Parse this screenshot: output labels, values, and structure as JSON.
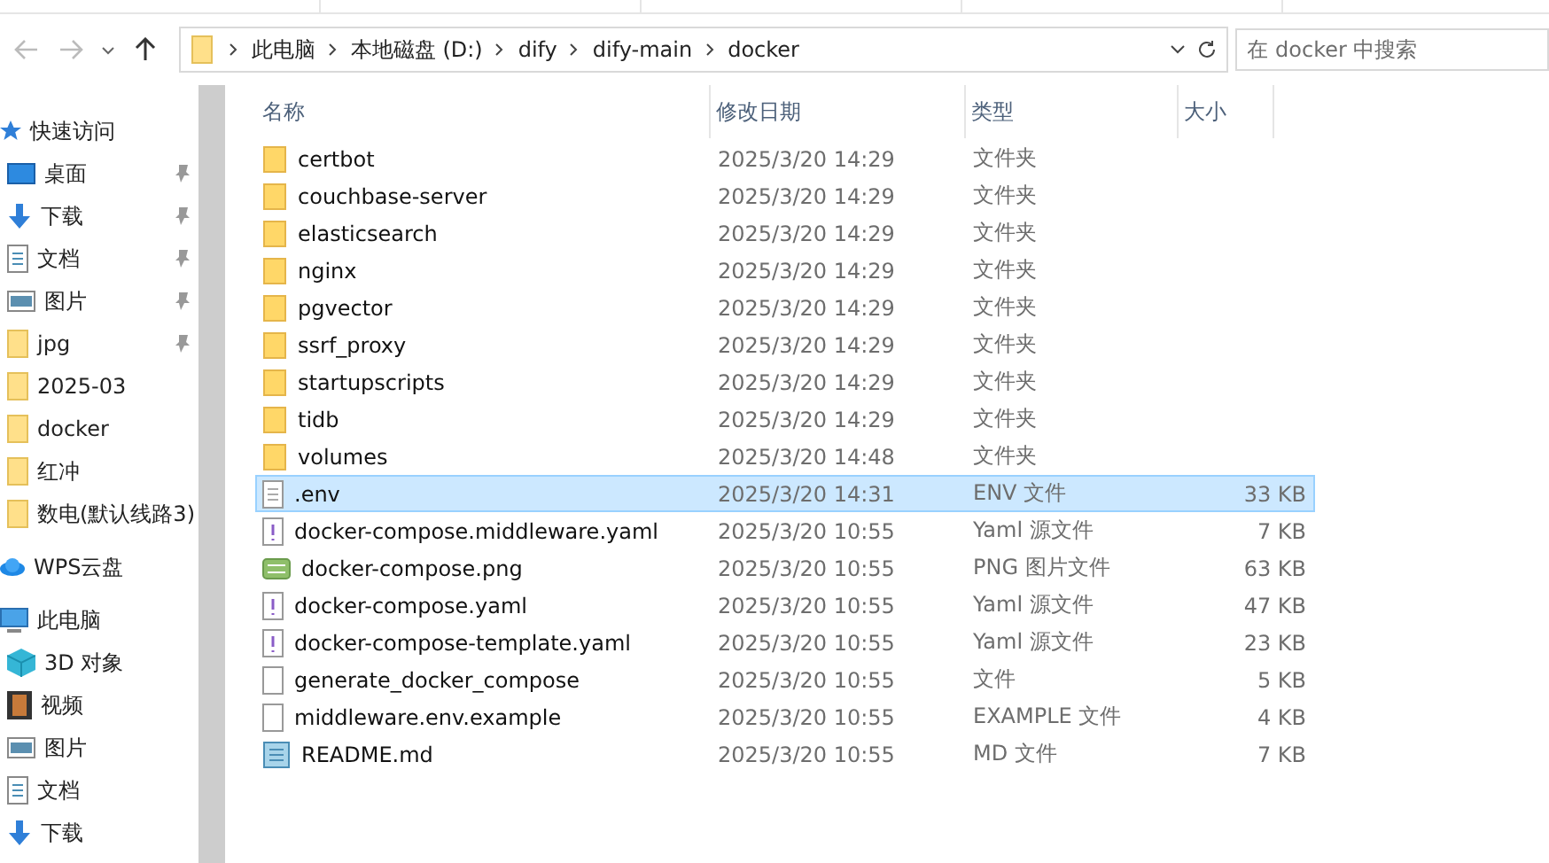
{
  "address": {
    "segments": [
      "此电脑",
      "本地磁盘 (D:)",
      "dify",
      "dify-main",
      "docker"
    ]
  },
  "search": {
    "placeholder": "在 docker 中搜索"
  },
  "sidebar": {
    "items": [
      {
        "label": "快速访问",
        "children": [
          {
            "label": "桌面",
            "pinned": true
          },
          {
            "label": "下载",
            "pinned": true
          },
          {
            "label": "文档",
            "pinned": true
          },
          {
            "label": "图片",
            "pinned": true
          },
          {
            "label": "jpg",
            "pinned": true
          },
          {
            "label": "2025-03",
            "pinned": false
          },
          {
            "label": "docker",
            "pinned": false
          },
          {
            "label": "红冲",
            "pinned": false
          },
          {
            "label": "数电(默认线路3)",
            "pinned": false
          }
        ]
      },
      {
        "label": "WPS云盘"
      },
      {
        "label": "此电脑",
        "children": [
          {
            "label": "3D 对象"
          },
          {
            "label": "视频"
          },
          {
            "label": "图片"
          },
          {
            "label": "文档"
          },
          {
            "label": "下载"
          }
        ]
      }
    ]
  },
  "table": {
    "columns": [
      "名称",
      "修改日期",
      "类型",
      "大小"
    ],
    "rows": [
      {
        "name": "certbot",
        "date": "2025/3/20 14:29",
        "type": "文件夹",
        "size": "",
        "kind": "folder",
        "selected": false
      },
      {
        "name": "couchbase-server",
        "date": "2025/3/20 14:29",
        "type": "文件夹",
        "size": "",
        "kind": "folder",
        "selected": false
      },
      {
        "name": "elasticsearch",
        "date": "2025/3/20 14:29",
        "type": "文件夹",
        "size": "",
        "kind": "folder",
        "selected": false
      },
      {
        "name": "nginx",
        "date": "2025/3/20 14:29",
        "type": "文件夹",
        "size": "",
        "kind": "folder",
        "selected": false
      },
      {
        "name": "pgvector",
        "date": "2025/3/20 14:29",
        "type": "文件夹",
        "size": "",
        "kind": "folder",
        "selected": false
      },
      {
        "name": "ssrf_proxy",
        "date": "2025/3/20 14:29",
        "type": "文件夹",
        "size": "",
        "kind": "folder",
        "selected": false
      },
      {
        "name": "startupscripts",
        "date": "2025/3/20 14:29",
        "type": "文件夹",
        "size": "",
        "kind": "folder",
        "selected": false
      },
      {
        "name": "tidb",
        "date": "2025/3/20 14:29",
        "type": "文件夹",
        "size": "",
        "kind": "folder",
        "selected": false
      },
      {
        "name": "volumes",
        "date": "2025/3/20 14:48",
        "type": "文件夹",
        "size": "",
        "kind": "folder",
        "selected": false
      },
      {
        "name": ".env",
        "date": "2025/3/20 14:31",
        "type": "ENV 文件",
        "size": "33 KB",
        "kind": "text",
        "selected": true
      },
      {
        "name": "docker-compose.middleware.yaml",
        "date": "2025/3/20 10:55",
        "type": "Yaml 源文件",
        "size": "7 KB",
        "kind": "yaml",
        "selected": false
      },
      {
        "name": "docker-compose.png",
        "date": "2025/3/20 10:55",
        "type": "PNG 图片文件",
        "size": "63 KB",
        "kind": "image",
        "selected": false
      },
      {
        "name": "docker-compose.yaml",
        "date": "2025/3/20 10:55",
        "type": "Yaml 源文件",
        "size": "47 KB",
        "kind": "yaml",
        "selected": false
      },
      {
        "name": "docker-compose-template.yaml",
        "date": "2025/3/20 10:55",
        "type": "Yaml 源文件",
        "size": "23 KB",
        "kind": "yaml",
        "selected": false
      },
      {
        "name": "generate_docker_compose",
        "date": "2025/3/20 10:55",
        "type": "文件",
        "size": "5 KB",
        "kind": "blank",
        "selected": false
      },
      {
        "name": "middleware.env.example",
        "date": "2025/3/20 10:55",
        "type": "EXAMPLE 文件",
        "size": "4 KB",
        "kind": "blank",
        "selected": false
      },
      {
        "name": "README.md",
        "date": "2025/3/20 10:55",
        "type": "MD 文件",
        "size": "7 KB",
        "kind": "notepad",
        "selected": false
      }
    ]
  }
}
